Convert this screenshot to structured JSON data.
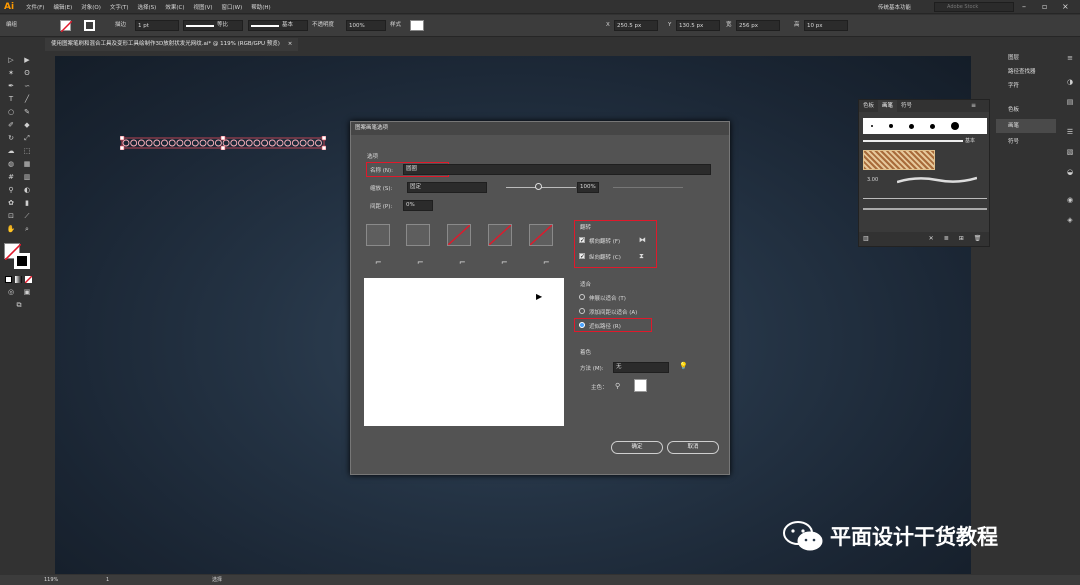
{
  "app": {
    "logo": "Ai",
    "menus": [
      "文件(F)",
      "编辑(E)",
      "对象(O)",
      "文字(T)",
      "选择(S)",
      "效果(C)",
      "视图(V)",
      "窗口(W)",
      "帮助(H)"
    ],
    "workspace": "传统基本功能",
    "stock_placeholder": "Adobe Stock"
  },
  "control": {
    "label": "编组",
    "stroke_label": "描边",
    "stroke_value": "1 pt",
    "profile": "等比",
    "brush": "基本",
    "opacity_label": "不透明度",
    "opacity_value": "100%",
    "style_label": "样式",
    "x_label": "X",
    "x_value": "250.5 px",
    "y_label": "Y",
    "y_value": "130.5 px",
    "w_label": "宽",
    "w_value": "256 px",
    "h_label": "高",
    "h_value": "10 px"
  },
  "document_tab": {
    "title": "使用图案笔刷和混合工具及变形工具绘制作3D放射状发光网纹.ai* @ 119% (RGB/GPU 预览)",
    "close": "×"
  },
  "status": {
    "zoom": "119%",
    "page": "1",
    "mode": "选择"
  },
  "brush_panel": {
    "tabs": [
      "色板",
      "画笔",
      "符号"
    ],
    "active_tab": "画笔",
    "basic_label": "基本",
    "size_label": "3.00"
  },
  "right_dock": {
    "items": [
      "图层",
      "路径查找器",
      "字符",
      "色板",
      "画笔",
      "符号"
    ]
  },
  "dialog": {
    "title": "图案画笔选项",
    "section_options": "选项",
    "name_label": "名称 (N):",
    "name_value": "圆圈",
    "scale_label": "缩放 (S):",
    "scale_mode": "固定",
    "scale_value": "100%",
    "spacing_label": "间距 (P):",
    "spacing_value": "0%",
    "flip_title": "翻转",
    "flip_h": "横向翻转 (F)",
    "flip_v": "纵向翻转 (C)",
    "fit_title": "适合",
    "fit_options": [
      "伸展以适合 (T)",
      "添加间距以适合 (A)",
      "近似路径 (R)"
    ],
    "fit_selected": 2,
    "color_title": "着色",
    "method_label": "方法 (M):",
    "method_value": "无",
    "key_color_label": "主色：",
    "ok_label": "确定",
    "cancel_label": "取消"
  },
  "watermark": {
    "text": "平面设计干货教程"
  },
  "colors": {
    "accent_red": "#e0192b",
    "ui_dark": "#323232",
    "dialog_bg": "#535353"
  }
}
